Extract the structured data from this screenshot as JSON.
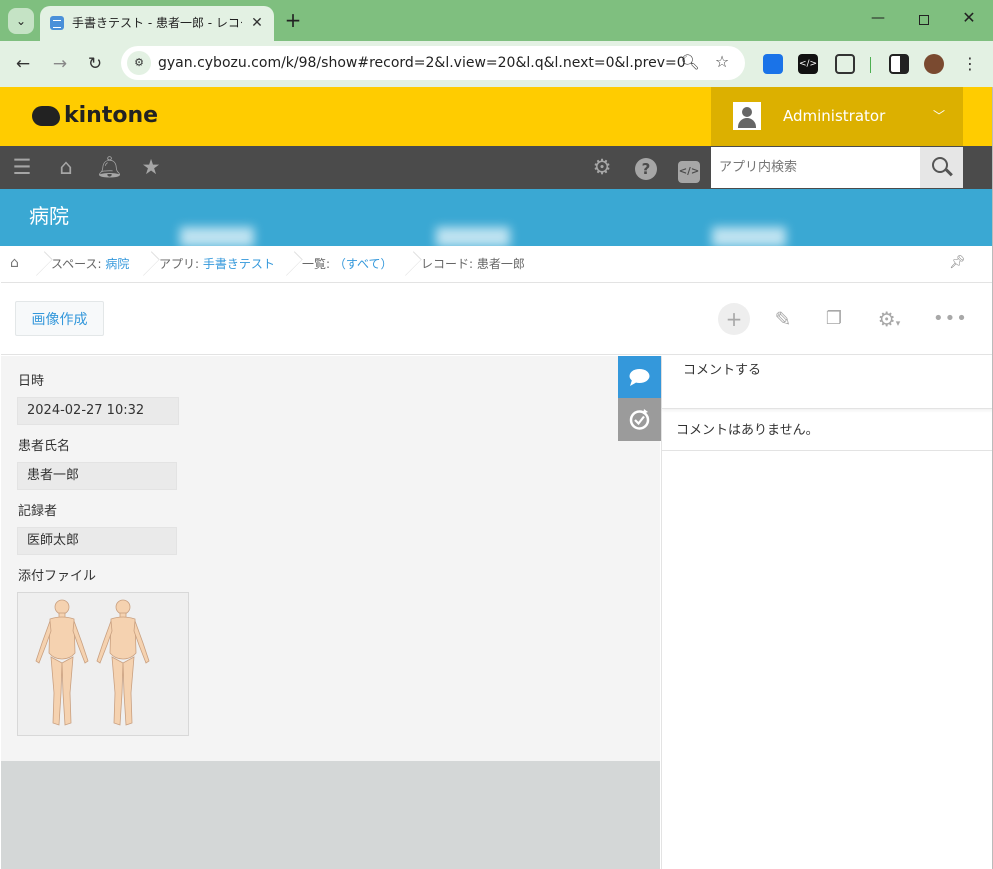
{
  "browser": {
    "tab_title": "手書きテスト - 患者一郎 - レコード(",
    "url": "gyan.cybozu.com/k/98/show#record=2&l.view=20&l.q&l.next=0&l.prev=0"
  },
  "header": {
    "logo_text": "kintone",
    "user_name": "Administrator"
  },
  "nav": {
    "search_placeholder": "アプリ内検索"
  },
  "app": {
    "title": "病院"
  },
  "breadcrumb": {
    "space_prefix": "スペース: ",
    "space_name": "病院",
    "app_prefix": "アプリ: ",
    "app_name": "手書きテスト",
    "list_prefix": "一覧: ",
    "list_name": "（すべて）",
    "record_label": "レコード: 患者一郎"
  },
  "actions": {
    "create_image_label": "画像作成"
  },
  "record": {
    "fields": [
      {
        "label": "日時",
        "value": "2024-02-27 10:32"
      },
      {
        "label": "患者氏名",
        "value": "患者一郎"
      },
      {
        "label": "記録者",
        "value": "医師太郎"
      },
      {
        "label": "添付ファイル"
      }
    ]
  },
  "comments": {
    "input_placeholder": "コメントする",
    "empty_message": "コメントはありません。"
  },
  "colors": {
    "header_yellow": "#ffcc00",
    "user_box": "#dcb000",
    "nav_dark": "#4b4b4b",
    "app_band": "#3aa8d3",
    "link_blue": "#3498db"
  }
}
